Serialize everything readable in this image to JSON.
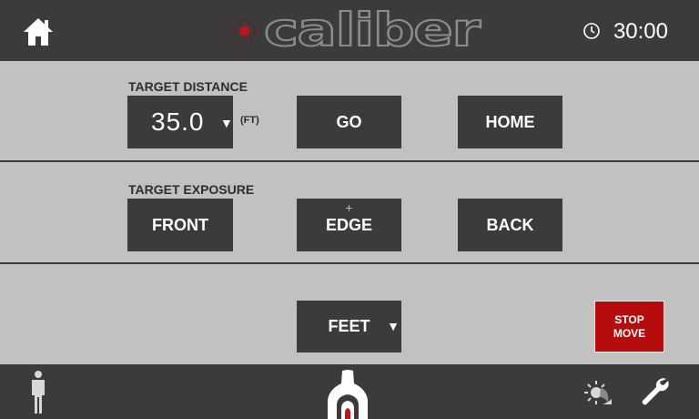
{
  "header": {
    "logo_text": "caliber",
    "timer": "30:00",
    "icons": {
      "home": "home-icon",
      "timer": "clock-icon"
    }
  },
  "distance": {
    "label": "TARGET DISTANCE",
    "value": "35.0",
    "unit": "(FT)",
    "go_label": "GO",
    "home_label": "HOME"
  },
  "exposure": {
    "label": "TARGET EXPOSURE",
    "front_label": "FRONT",
    "edge_label": "EDGE",
    "edge_plus": "+",
    "back_label": "BACK"
  },
  "units": {
    "feet_label": "FEET",
    "dropdown_arrow": "▼"
  },
  "stop": {
    "line1": "STOP",
    "line2": "MOVE"
  },
  "footer": {
    "icons": [
      "person-icon",
      "target-silhouette-icon",
      "brightness-icon",
      "wrench-icon"
    ]
  },
  "colors": {
    "bar": "#3c3a3b",
    "panel": "#c1c1c1",
    "stop": "#b50d0d",
    "logo_accent": "#c0141c"
  }
}
